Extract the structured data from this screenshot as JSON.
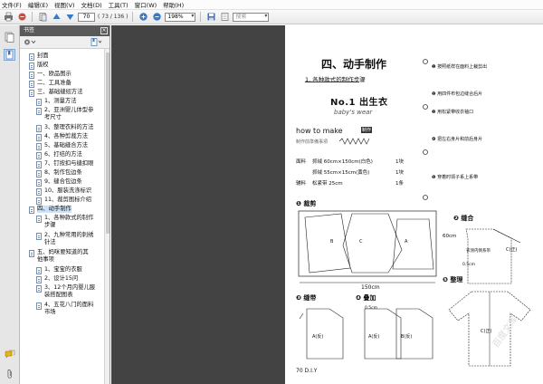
{
  "menu": [
    "文件(F)",
    "编辑(E)",
    "视图(V)",
    "文档(D)",
    "工具(T)",
    "窗口(W)",
    "帮助(H)"
  ],
  "toolbar": {
    "page_current": "70",
    "page_count": "( 73 / 136 )",
    "zoom": "198%",
    "search_placeholder": "搜索"
  },
  "panel": {
    "title": "书签",
    "close_glyph": "×"
  },
  "bookmarks": [
    {
      "text": "封面"
    },
    {
      "text": "版权"
    },
    {
      "text": "一、欧品图示"
    },
    {
      "text": "二、工具准备"
    },
    {
      "text": "三、基础缝纫方法"
    },
    {
      "text": "1、测量方法"
    },
    {
      "text": "2、亚洲婴儿体型参"
    },
    {
      "text": "考尺寸"
    },
    {
      "text": "3、整理衣料的方法"
    },
    {
      "text": "4、各种剪裁方法"
    },
    {
      "text": "5、基础缝合方法"
    },
    {
      "text": "6、打结的方法"
    },
    {
      "text": "7、钉按扣与缝扣眼"
    },
    {
      "text": "8、制作包边条"
    },
    {
      "text": "9、缝合包边条"
    },
    {
      "text": "10、服装洗涤标识"
    },
    {
      "text": "11、裁剪图标介绍"
    },
    {
      "text": "四、动手制作"
    },
    {
      "text": "1、各种款式的制作"
    },
    {
      "text": "步骤"
    },
    {
      "text": "2、九种常用的刺绣"
    },
    {
      "text": "针法"
    },
    {
      "text": "五、妈咪要知道的其"
    },
    {
      "text": "他事项"
    },
    {
      "text": "1、宝宝的衣服"
    },
    {
      "text": "2、设计15问"
    },
    {
      "text": "3、12个月内婴儿服"
    },
    {
      "text": "装搭配图表"
    },
    {
      "text": "4、五花八门的面料"
    },
    {
      "text": "市场"
    }
  ],
  "doc": {
    "heading": "四、动手制作",
    "subheading": "1. 各种款式的制作步骤",
    "card_title": "No.1 出生衣",
    "card_sub": "baby's wear",
    "howto": "how to make",
    "howto_badge": "制作",
    "howto_caption": "制作前準備事項",
    "materials": [
      [
        "面料",
        "抓绒 60cm×150cm(白色)",
        "1块"
      ],
      [
        "",
        "抓绒 55cm×15cm(黄色)",
        "1块"
      ],
      [
        "辅料",
        "松紧带 25cm",
        "1条"
      ]
    ],
    "steps": [
      {
        "num": "1",
        "text": "按照纸样在面料上裁剪出"
      },
      {
        "num": "2",
        "text": "用四件布包边缝合后片"
      },
      {
        "num": "3",
        "text": "用松紧带收衣袖口"
      },
      {
        "num": "4",
        "text": "把左右身片和前后身片"
      },
      {
        "num": "5",
        "text": "穿着时领子系上系带"
      }
    ],
    "section_cut": "裁剪",
    "section_sew": "缝合",
    "section_band": "缝带",
    "section_fold": "叠加",
    "section_finish": "整理",
    "label_150": "150cm",
    "label_60": "60cm",
    "label_05a": "0.5cm",
    "label_05b": "0.5cm",
    "label_collar": "衣领内侧系带",
    "piece_a": "A",
    "piece_b": "B",
    "piece_c": "C",
    "piece_cl": "C(正)",
    "piece_al": "A(反)",
    "piece_bl": "B(反)",
    "footer": "70 D.I.Y",
    "watermark": "百度文库"
  },
  "colors": {
    "panel_header": "#5a5a5a",
    "doc_bg": "#525252",
    "selected": "#cfe1f6"
  }
}
